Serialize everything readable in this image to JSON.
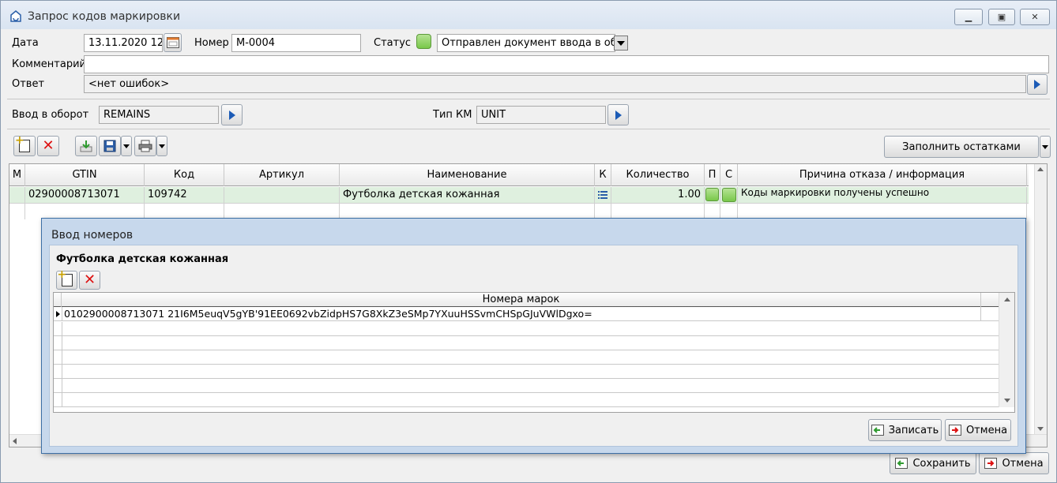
{
  "window": {
    "title": "Запрос кодов маркировки"
  },
  "form": {
    "date_label": "Дата",
    "date_value": "13.11.2020 12",
    "number_label": "Номер",
    "number_value": "М-0004",
    "status_label": "Статус",
    "status_value": "Отправлен документ ввода в оборо",
    "comment_label": "Комментарий",
    "comment_value": "",
    "answer_label": "Ответ",
    "answer_value": "<нет ошибок>",
    "circulation_label": "Ввод в оборот",
    "circulation_value": "REMAINS",
    "km_type_label": "Тип КМ",
    "km_type_value": "UNIT"
  },
  "toolbar": {
    "fill_button_label": "Заполнить остатками"
  },
  "grid": {
    "columns": [
      "М",
      "GTIN",
      "Код",
      "Артикул",
      "Наименование",
      "К",
      "Количество",
      "П",
      "С",
      "Причина отказа / информация"
    ],
    "rows": [
      {
        "m": "",
        "gtin": "02900008713071",
        "code": "109742",
        "article": "",
        "name": "Футболка детская кожанная",
        "qty": "1.00",
        "info": "Коды маркировки получены успешно"
      }
    ]
  },
  "dialog": {
    "title": "Ввод номеров",
    "product_name": "Футболка детская кожанная",
    "column_header": "Номера марок",
    "rows": [
      "0102900008713071 21I6M5euqV5gYB'91EE0692vbZidpHS7G8XkZ3eSMp7YXuuHSSvmCHSpGJuVWlDgxo="
    ],
    "save_label": "Записать",
    "cancel_label": "Отмена"
  },
  "footer": {
    "save_label": "Сохранить",
    "cancel_label": "Отмена"
  },
  "colors": {
    "selected_row": "#dff0df",
    "status_green": "#79c84a",
    "dialog_frame": "#c7d8ec"
  }
}
